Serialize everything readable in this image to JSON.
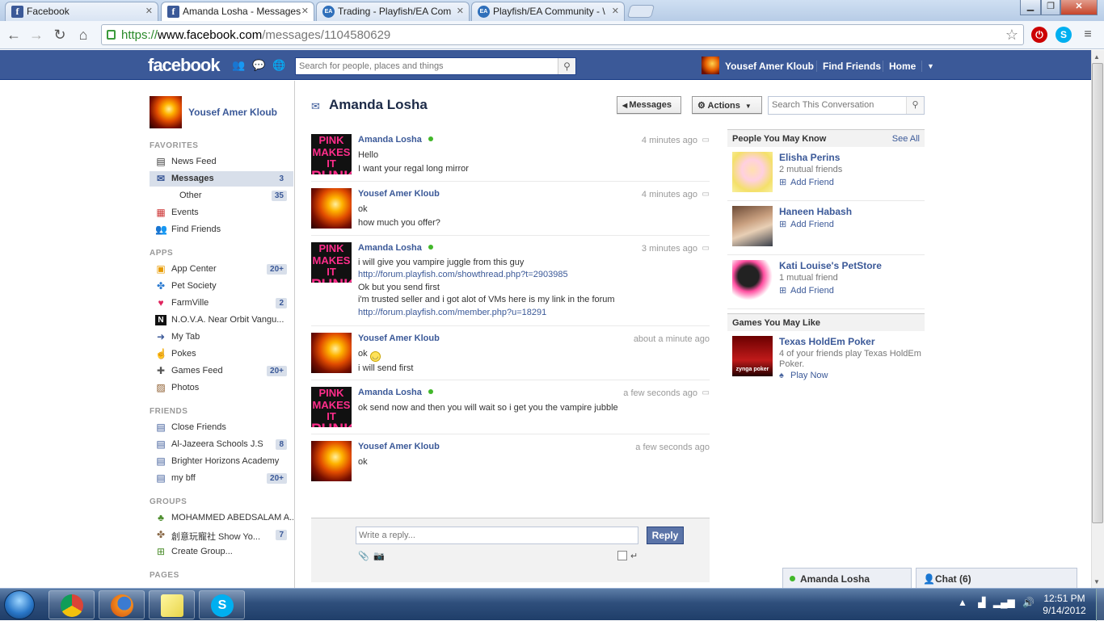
{
  "browser": {
    "tabs": [
      {
        "title": "Facebook",
        "icon": "facebook-icon",
        "active": false
      },
      {
        "title": "Amanda Losha - Messages",
        "icon": "facebook-icon",
        "active": true
      },
      {
        "title": "Trading - Playfish/EA Com",
        "icon": "ea-icon",
        "active": false
      },
      {
        "title": "Playfish/EA Community - \\",
        "icon": "ea-icon",
        "active": false
      }
    ],
    "url_scheme": "https://",
    "url_host": "www.facebook.com",
    "url_path": "/messages/1104580629"
  },
  "fb_header": {
    "logo": "facebook",
    "search_placeholder": "Search for people, places and things",
    "user_name": "Yousef Amer Kloub",
    "find_friends": "Find Friends",
    "home": "Home"
  },
  "left_nav": {
    "profile_name": "Yousef Amer Kloub",
    "favorites_head": "FAVORITES",
    "favorites": [
      {
        "label": "News Feed",
        "icon": "news-feed-icon",
        "count": ""
      },
      {
        "label": "Messages",
        "icon": "messages-icon",
        "count": "3"
      },
      {
        "label": "Other",
        "icon": "",
        "count": "35"
      },
      {
        "label": "Events",
        "icon": "calendar-icon",
        "count": ""
      },
      {
        "label": "Find Friends",
        "icon": "friends-icon",
        "count": ""
      }
    ],
    "apps_head": "APPS",
    "apps": [
      {
        "label": "App Center",
        "icon": "app-center-icon",
        "count": "20+"
      },
      {
        "label": "Pet Society",
        "icon": "paw-icon",
        "count": ""
      },
      {
        "label": "FarmVille",
        "icon": "heart-icon",
        "count": "2"
      },
      {
        "label": "N.O.V.A. Near Orbit Vangu...",
        "icon": "nova-icon",
        "count": ""
      },
      {
        "label": "My Tab",
        "icon": "my-tab-icon",
        "count": ""
      },
      {
        "label": "Pokes",
        "icon": "poke-icon",
        "count": ""
      },
      {
        "label": "Games Feed",
        "icon": "games-feed-icon",
        "count": "20+"
      },
      {
        "label": "Photos",
        "icon": "photos-icon",
        "count": ""
      }
    ],
    "friends_head": "FRIENDS",
    "friends": [
      {
        "label": "Close Friends",
        "icon": "star-friends-icon",
        "count": ""
      },
      {
        "label": "Al-Jazeera Schools J.S",
        "icon": "school-icon",
        "count": "8"
      },
      {
        "label": "Brighter Horizons Academy",
        "icon": "school-icon",
        "count": ""
      },
      {
        "label": "my bff",
        "icon": "list-icon",
        "count": "20+"
      }
    ],
    "groups_head": "GROUPS",
    "groups": [
      {
        "label": "MOHAMMED ABEDSALAM A...",
        "icon": "tree-icon",
        "count": ""
      },
      {
        "label": "創意玩寵社 Show Yo...",
        "icon": "paw-group-icon",
        "count": "7"
      },
      {
        "label": "Create Group...",
        "icon": "create-group-icon",
        "count": ""
      }
    ],
    "pages_head": "PAGES"
  },
  "conversation": {
    "title": "Amanda Losha",
    "messages_button": "Messages",
    "actions_button": "Actions",
    "search_placeholder": "Search This Conversation",
    "messages": [
      {
        "sender": "Amanda Losha",
        "online": true,
        "time": "4 minutes ago",
        "lines": [
          "Hello",
          "I want your regal long mirror"
        ]
      },
      {
        "sender": "Yousef Amer Kloub",
        "online": false,
        "time": "4 minutes ago",
        "lines": [
          "ok",
          "how much you offer?"
        ]
      },
      {
        "sender": "Amanda Losha",
        "online": true,
        "time": "3 minutes ago",
        "lines": [
          "i will give you vampire juggle from this guy",
          "http://forum.playfish.com/showthread.php?t=2903985",
          "Ok but you send first",
          "i'm trusted seller and i got alot of VMs here is my link in the forum",
          "http://forum.playfish.com/member.php?u=18291"
        ]
      },
      {
        "sender": "Yousef Amer Kloub",
        "online": false,
        "time": "about a minute ago",
        "lines": [
          "ok",
          "i will send first"
        ]
      },
      {
        "sender": "Amanda Losha",
        "online": true,
        "time": "a few seconds ago",
        "lines": [
          "ok send now and then you will wait so i get you the vampire jubble"
        ]
      },
      {
        "sender": "Yousef Amer Kloub",
        "online": false,
        "time": "a few seconds ago",
        "lines": [
          "ok"
        ]
      }
    ],
    "reply_placeholder": "Write a reply...",
    "reply_button": "Reply"
  },
  "right_col": {
    "pymk_head": "People You May Know",
    "see_all": "See All",
    "people": [
      {
        "name": "Elisha Perins",
        "mutual": "2 mutual friends",
        "add": "Add Friend"
      },
      {
        "name": "Haneen Habash",
        "mutual": "",
        "add": "Add Friend"
      },
      {
        "name": "Kati Louise's PetStore",
        "mutual": "1 mutual friend",
        "add": "Add Friend"
      }
    ],
    "games_head": "Games You May Like",
    "game": {
      "name": "Texas HoldEm Poker",
      "desc": "4 of your friends play Texas HoldEm Poker.",
      "play": "Play Now",
      "logo_text": "zynga poker"
    }
  },
  "chat": {
    "conversation_tab": "Amanda Losha",
    "chat_tab": "Chat (6)"
  },
  "taskbar": {
    "time": "12:51 PM",
    "date": "9/14/2012"
  },
  "colors": {
    "fb_blue": "#3b5998",
    "link": "#3b5998",
    "online": "#42b72a"
  }
}
